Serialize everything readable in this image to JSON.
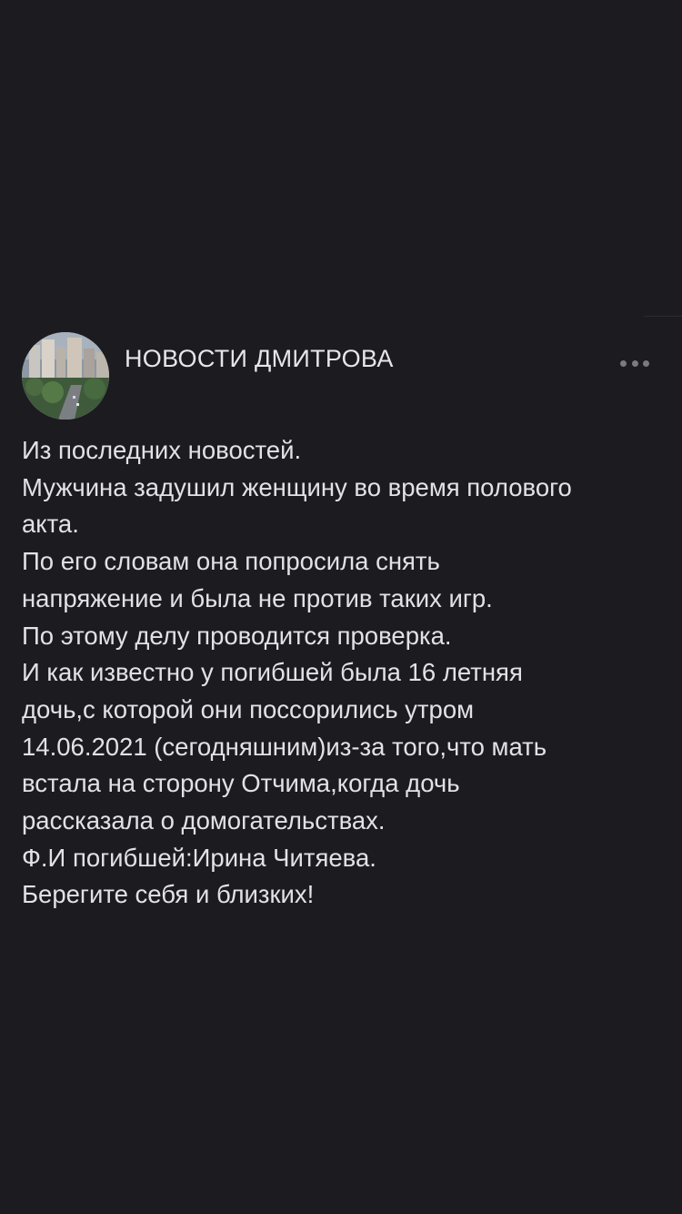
{
  "post": {
    "group_name": "НОВОСТИ ДМИТРОВА",
    "more_icon": "ellipsis-icon",
    "avatar_icon": "city-photo",
    "lines": [
      "Из последних новостей.",
      "Мужчина задушил женщину во время полового",
      "акта.",
      "По его словам она попросила снять",
      "напряжение и была не против таких игр.",
      "По этому делу проводится проверка.",
      "И как известно у погибшей была 16 летняя",
      "дочь,с которой они поссорились утром",
      "14.06.2021 (сегодняшним)из-за того,что мать",
      "встала на сторону Отчима,когда дочь",
      "рассказала о домогательствах.",
      "Ф.И погибшей:Ирина Читяева.",
      "Берегите себя и близких!"
    ]
  },
  "colors": {
    "background": "#1c1b20",
    "text": "#e2e2e4",
    "muted": "#7b7a80"
  }
}
